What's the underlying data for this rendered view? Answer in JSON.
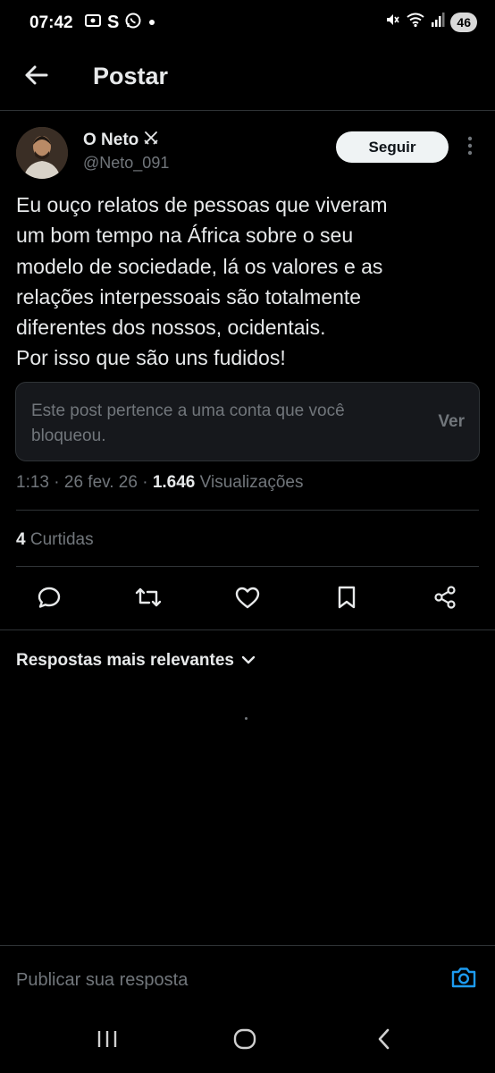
{
  "status_bar": {
    "time": "07:42",
    "left_icons": [
      "screenshot-icon",
      "s-app-icon",
      "whatsapp-icon",
      "dot-icon"
    ],
    "right_icons": [
      "mute-icon",
      "wifi-icon",
      "signal-icon"
    ],
    "battery": "46"
  },
  "header": {
    "back_icon": "arrow-left-icon",
    "title": "Postar"
  },
  "post": {
    "author_name": "O Neto",
    "author_badge_icon": "crossed-swords-icon",
    "author_handle": "@Neto_091",
    "follow_label": "Seguir",
    "text": "Eu ouço relatos de pessoas que viveram\num bom tempo na África sobre o seu\nmodelo de sociedade, lá os valores e as\nrelações interpessoais são totalmente\ndiferentes dos nossos, ocidentais.\nPor isso que são uns fudidos!",
    "blocked_notice": "Este post pertence a uma conta que você bloqueou.",
    "view_label": "Ver",
    "time": "1:13",
    "date": "26 fev. 26",
    "views_count": "1.646",
    "views_label": "Visualizações",
    "likes_count": "4",
    "likes_label": "Curtidas"
  },
  "actions": [
    "reply-icon",
    "repost-icon",
    "like-icon",
    "bookmark-icon",
    "share-icon"
  ],
  "replies": {
    "sort_label": "Respostas mais relevantes"
  },
  "reply_bar": {
    "placeholder": "Publicar sua resposta"
  },
  "colors": {
    "background": "#000000",
    "text_primary": "#e7e9ea",
    "text_secondary": "#71767b",
    "divider": "#2f3336",
    "accent": "#1d9bf0"
  }
}
